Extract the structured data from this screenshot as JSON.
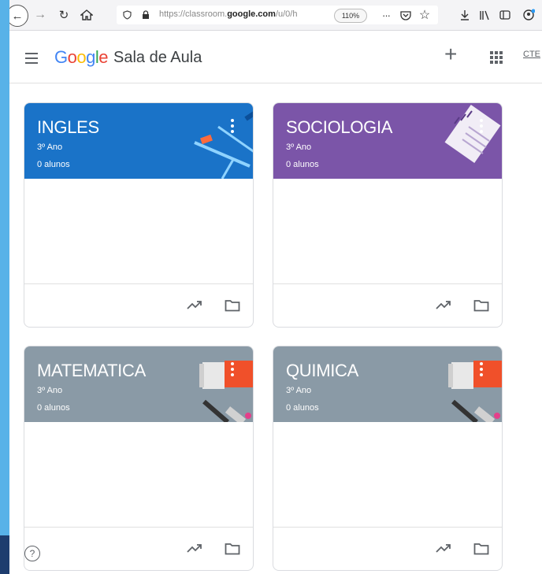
{
  "browser": {
    "url_prefix": "https://classroom.",
    "url_domain": "google.com",
    "url_suffix": "/u/0/h",
    "zoom": "110%",
    "more_label": "···"
  },
  "header": {
    "logo_letters": [
      "G",
      "o",
      "o",
      "g",
      "l",
      "e"
    ],
    "logo_colors": [
      "#4285f4",
      "#ea4335",
      "#fbbc05",
      "#4285f4",
      "#34a853",
      "#ea4335"
    ],
    "app_name": "Sala de Aula",
    "plus_label": "+",
    "account_label": "CTE"
  },
  "classes": [
    {
      "title": "INGLES",
      "section": "3º Ano",
      "students": "0 alunos",
      "color": "#1a73c8"
    },
    {
      "title": "SOCIOLOGIA",
      "section": "3º Ano",
      "students": "0 alunos",
      "color": "#7b55a8"
    },
    {
      "title": "MATEMATICA",
      "section": "3º Ano",
      "students": "0 alunos",
      "color": "#8a9aa6"
    },
    {
      "title": "QUIMICA",
      "section": "3º Ano",
      "students": "0 alunos",
      "color": "#8a9aa6"
    }
  ],
  "help_label": "?",
  "icons": [
    "back-icon",
    "forward-icon",
    "reload-icon",
    "home-icon",
    "shield-icon",
    "lock-icon",
    "pocket-icon",
    "star-icon",
    "download-icon",
    "library-icon",
    "sidebar-icon",
    "profile-icon",
    "menu-icon",
    "add-icon",
    "apps-icon",
    "more-vert-icon",
    "trending-icon",
    "folder-icon",
    "help-icon"
  ]
}
